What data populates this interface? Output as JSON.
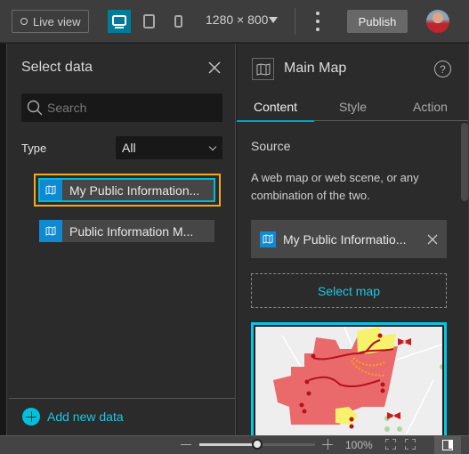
{
  "topbar": {
    "live_view_label": "Live view",
    "devices": [
      {
        "name": "desktop",
        "active": true
      },
      {
        "name": "tablet",
        "active": false
      },
      {
        "name": "phone",
        "active": false
      }
    ],
    "resolution": "1280 × 800",
    "publish_label": "Publish",
    "accent": "#007c99"
  },
  "select_data": {
    "title": "Select data",
    "search_placeholder": "Search",
    "type_label": "Type",
    "type_value": "All",
    "items": [
      {
        "label": "My Public Information...",
        "selected": true
      },
      {
        "label": "Public Information M...",
        "selected": false
      }
    ],
    "add_new_label": "Add new data"
  },
  "settings": {
    "title": "Main Map",
    "help_glyph": "?",
    "tabs": [
      {
        "label": "Content",
        "active": true
      },
      {
        "label": "Style",
        "active": false
      },
      {
        "label": "Action",
        "active": false
      }
    ],
    "source_title": "Source",
    "source_description": "A web map or web scene, or any combination of the two.",
    "selected_map_label": "My Public Informatio...",
    "select_map_label": "Select map"
  },
  "bottombar": {
    "zoom_level": "100%",
    "zoom_fraction": 0.5
  },
  "colors": {
    "selection_outline": "#f6a81d",
    "focus_outline": "#00bcd4",
    "map_icon_blue": "#0f8ad1",
    "link_cyan": "#1cc7e2"
  }
}
